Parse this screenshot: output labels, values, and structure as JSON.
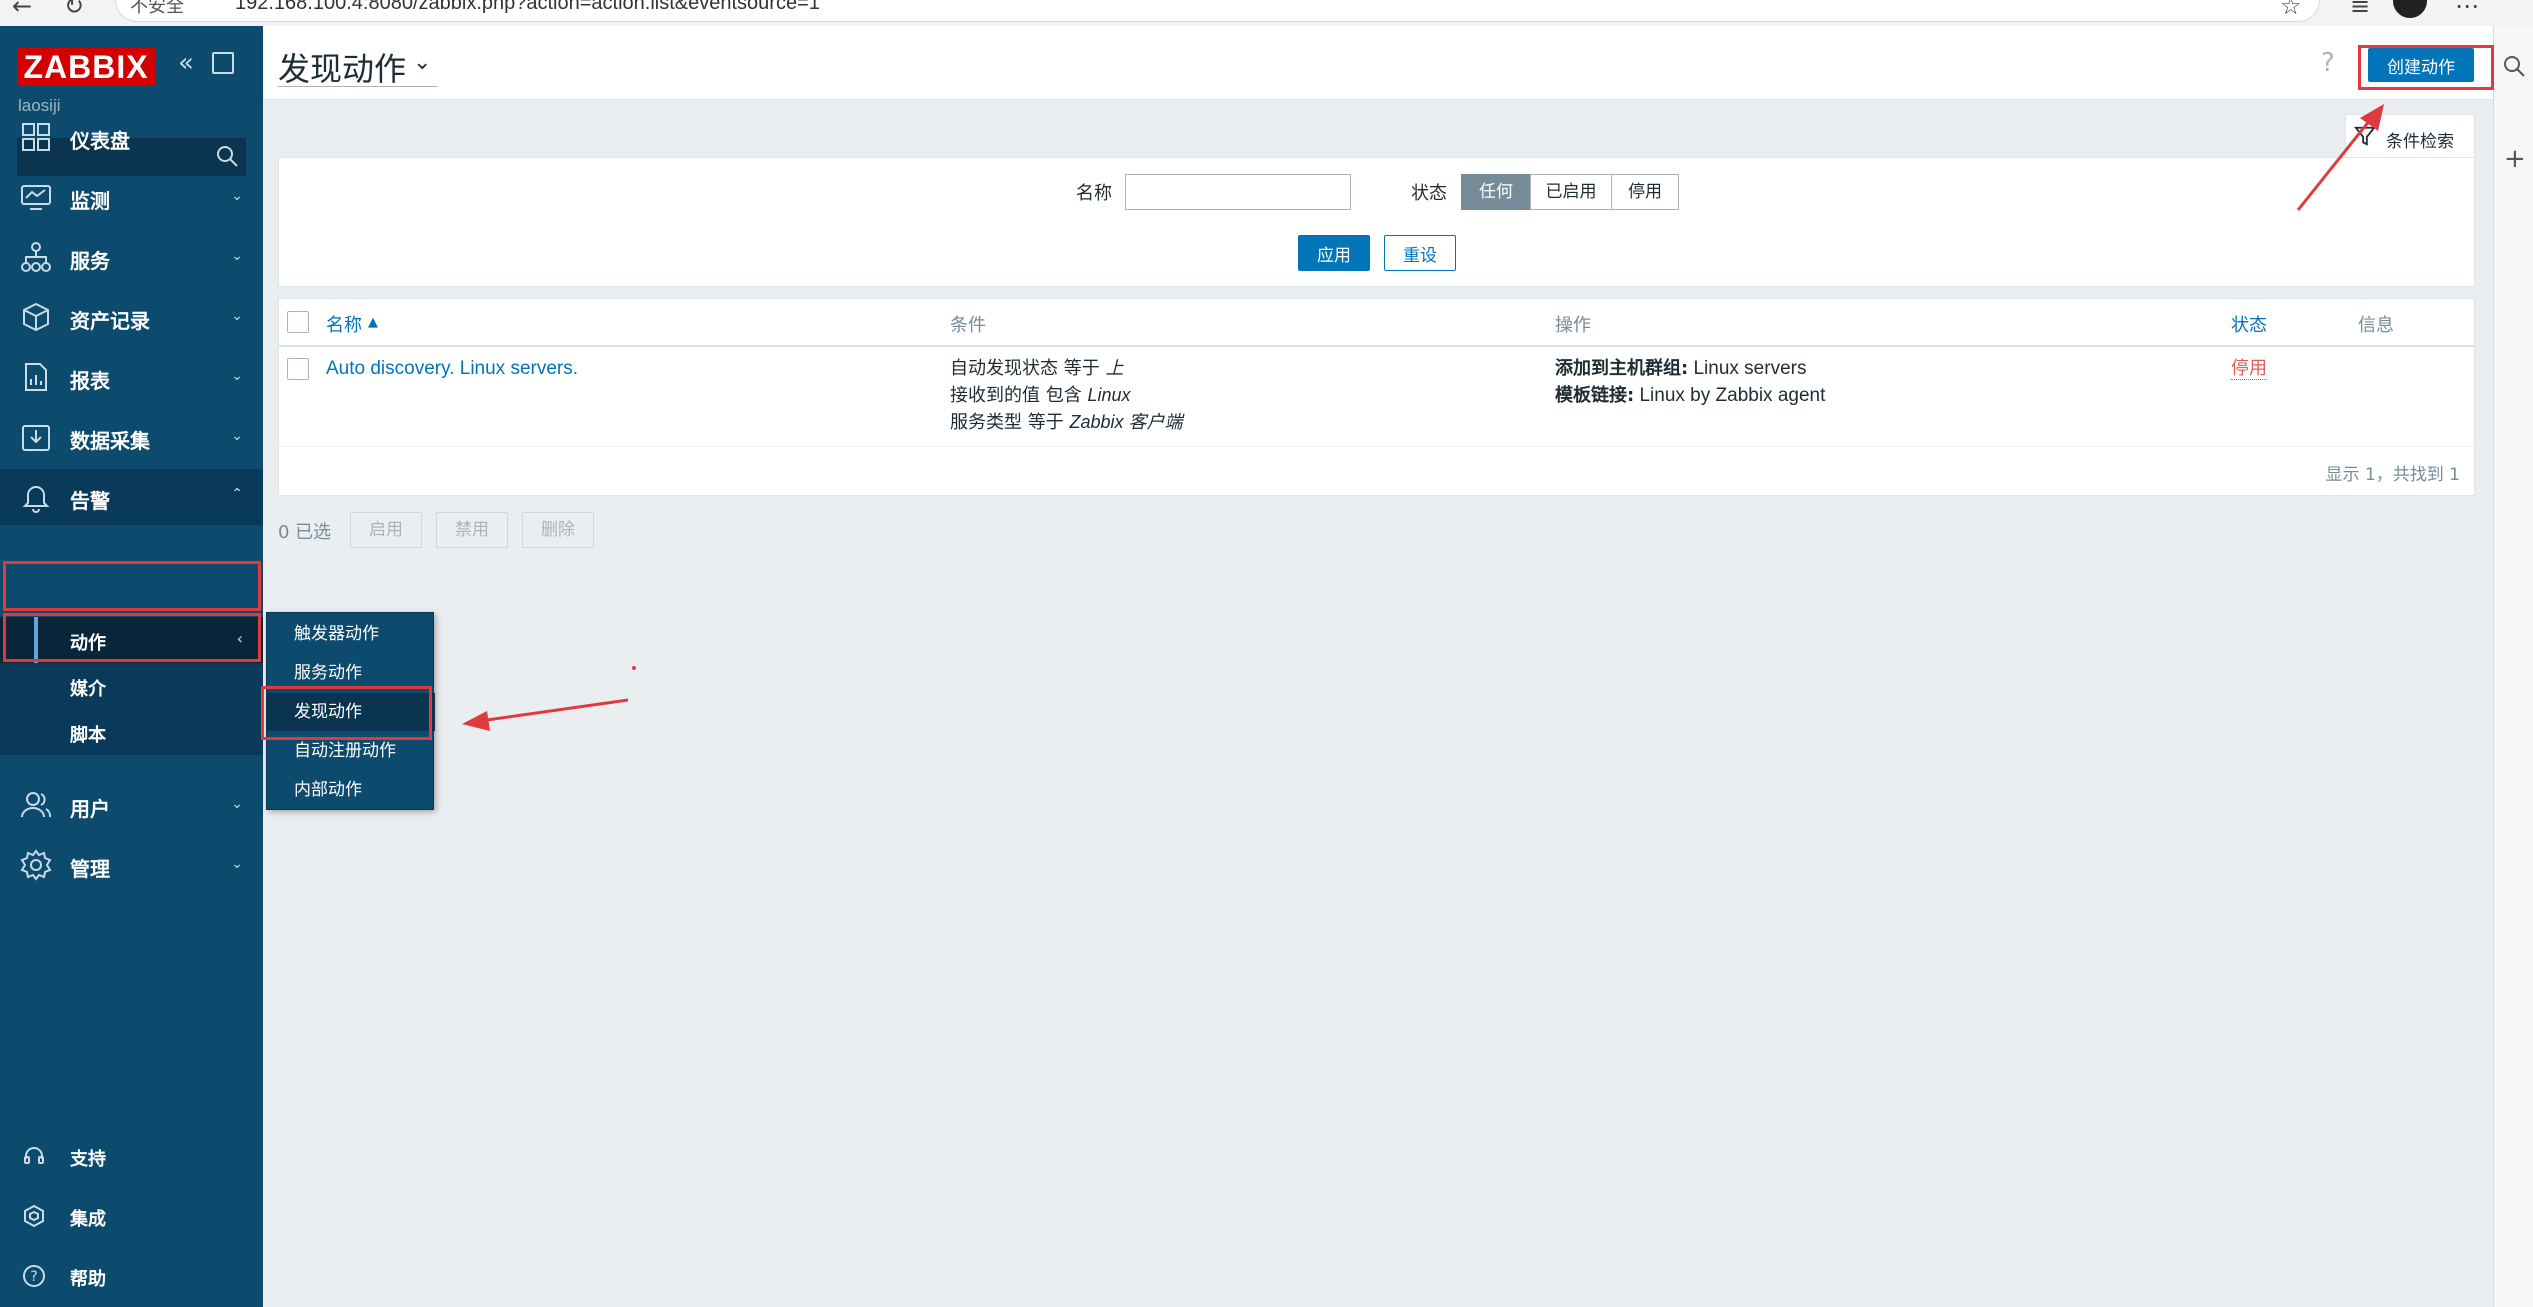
{
  "browser": {
    "security_label": "不安全",
    "url": "192.168.100.4:8080/zabbix.php?action=action.list&eventsource=1"
  },
  "sidebar": {
    "logo": "ZABBIX",
    "username": "laosiji",
    "search_placeholder": "",
    "items": [
      {
        "label": "仪表盘",
        "icon": "dashboard-icon"
      },
      {
        "label": "监测",
        "icon": "monitoring-icon"
      },
      {
        "label": "服务",
        "icon": "services-icon"
      },
      {
        "label": "资产记录",
        "icon": "inventory-icon"
      },
      {
        "label": "报表",
        "icon": "reports-icon"
      },
      {
        "label": "数据采集",
        "icon": "data-collection-icon"
      },
      {
        "label": "告警",
        "icon": "bell-icon"
      }
    ],
    "alerts_submenu": [
      {
        "label": "动作"
      },
      {
        "label": "媒介"
      },
      {
        "label": "脚本"
      }
    ],
    "items_after": [
      {
        "label": "用户",
        "icon": "users-icon"
      },
      {
        "label": "管理",
        "icon": "gear-icon"
      }
    ],
    "bottom": [
      {
        "label": "支持",
        "icon": "headset-icon"
      },
      {
        "label": "集成",
        "icon": "integrations-icon"
      },
      {
        "label": "帮助",
        "icon": "help-icon"
      }
    ]
  },
  "flyout": {
    "items": [
      "触发器动作",
      "服务动作",
      "发现动作",
      "自动注册动作",
      "内部动作"
    ]
  },
  "header": {
    "title": "发现动作",
    "help": "?",
    "create_button": "创建动作"
  },
  "filter": {
    "tab_label": "条件检索",
    "name_label": "名称",
    "name_value": "",
    "status_label": "状态",
    "status_options": [
      "任何",
      "已启用",
      "停用"
    ],
    "status_selected": "任何",
    "apply": "应用",
    "reset": "重设"
  },
  "table": {
    "columns": {
      "name": "名称",
      "sort_indicator": "▲",
      "conditions": "条件",
      "operations": "操作",
      "status": "状态",
      "info": "信息"
    },
    "rows": [
      {
        "name": "Auto discovery. Linux servers.",
        "conditions": [
          {
            "text": "自动发现状态 等于 ",
            "value": "上"
          },
          {
            "text": "接收到的值 包含 ",
            "value": "Linux"
          },
          {
            "text": "服务类型 等于 ",
            "value": "Zabbix 客户端"
          }
        ],
        "operations": [
          {
            "key": "添加到主机群组:",
            "value": " Linux servers"
          },
          {
            "key": "模板链接:",
            "value": " Linux by Zabbix agent"
          }
        ],
        "status": "停用"
      }
    ],
    "footer": "显示 1，共找到 1"
  },
  "mass_actions": {
    "selected": "0 已选",
    "buttons": [
      "启用",
      "禁用",
      "删除"
    ]
  },
  "colors": {
    "sidebar": "#0c4a6e",
    "primary": "#0275b8",
    "annotation": "#e0393e",
    "disabled_status": "#e45959"
  }
}
